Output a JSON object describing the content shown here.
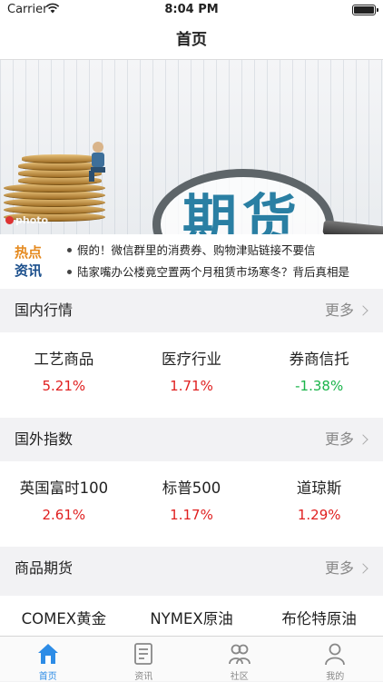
{
  "status_bar": {
    "carrier": "Carrier",
    "time": "8:04 PM"
  },
  "nav": {
    "title": "首页"
  },
  "banner": {
    "headline": "期货",
    "watermark": "photo"
  },
  "hot_news": {
    "logo_line1": "热点",
    "logo_line2": "资讯",
    "items": [
      "假的！微信群里的消费券、购物津贴链接不要信",
      "陆家嘴办公楼竟空置两个月租赁市场寒冬？背后真相是"
    ]
  },
  "sections": {
    "domestic": {
      "title": "国内行情",
      "more": "更多",
      "quotes": [
        {
          "name": "工艺商品",
          "change": "5.21%",
          "trend": "up"
        },
        {
          "name": "医疗行业",
          "change": "1.71%",
          "trend": "up"
        },
        {
          "name": "券商信托",
          "change": "-1.38%",
          "trend": "down"
        }
      ]
    },
    "foreign": {
      "title": "国外指数",
      "more": "更多",
      "quotes": [
        {
          "name": "英国富时100",
          "change": "2.61%",
          "trend": "up"
        },
        {
          "name": "标普500",
          "change": "1.17%",
          "trend": "up"
        },
        {
          "name": "道琼斯",
          "change": "1.29%",
          "trend": "up"
        }
      ]
    },
    "commodities": {
      "title": "商品期货",
      "more": "更多",
      "quotes": [
        {
          "name": "COMEX黄金"
        },
        {
          "name": "NYMEX原油"
        },
        {
          "name": "布伦特原油"
        }
      ]
    }
  },
  "tabs": [
    {
      "label": "首页",
      "icon": "home-icon",
      "active": true
    },
    {
      "label": "资讯",
      "icon": "news-icon",
      "active": false
    },
    {
      "label": "社区",
      "icon": "community-icon",
      "active": false
    },
    {
      "label": "我的",
      "icon": "profile-icon",
      "active": false
    }
  ],
  "colors": {
    "up": "#e02020",
    "down": "#1ab44a",
    "accent": "#2d8ce6"
  }
}
